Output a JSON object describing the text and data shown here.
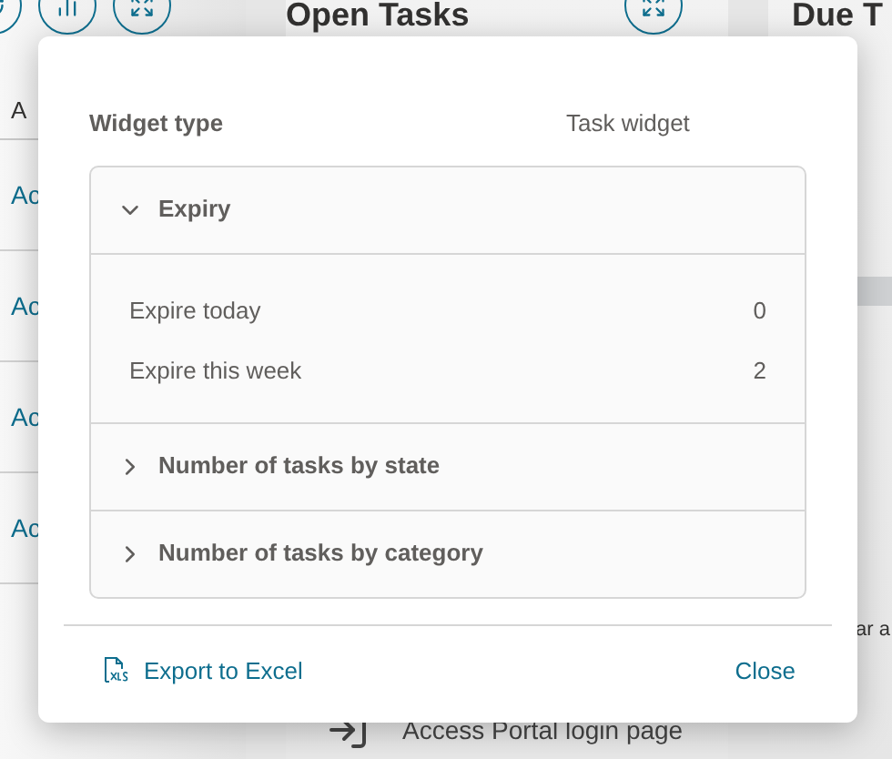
{
  "background": {
    "left_panel": {
      "header_label": "A",
      "rows": [
        "Ac",
        "Ac",
        "Ac",
        "Ac"
      ]
    },
    "open_tasks": {
      "title": "Open Tasks"
    },
    "due_panel": {
      "title": "Due T",
      "row_text": "ar a"
    },
    "list_item": {
      "title": "Access Portal login page"
    }
  },
  "dialog": {
    "widget_type_label": "Widget type",
    "widget_type_value": "Task widget",
    "sections": [
      {
        "title": "Expiry",
        "expanded": true,
        "rows": [
          {
            "label": "Expire today",
            "value": "0"
          },
          {
            "label": "Expire this week",
            "value": "2"
          }
        ]
      },
      {
        "title": "Number of tasks by state",
        "expanded": false
      },
      {
        "title": "Number of tasks by category",
        "expanded": false
      }
    ],
    "export_label": "Export to Excel",
    "close_label": "Close"
  }
}
